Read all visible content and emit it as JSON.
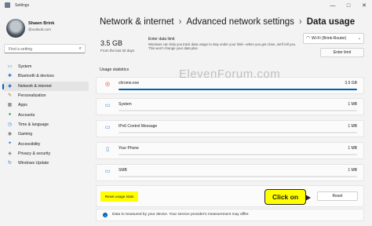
{
  "window": {
    "title": "Settings",
    "controls": [
      "—",
      "□",
      "✕"
    ]
  },
  "profile": {
    "name": "Shawn Brink",
    "email": "@outlook.com"
  },
  "search": {
    "placeholder": "Find a setting"
  },
  "nav": [
    {
      "label": "System",
      "icon": "monitor-icon",
      "glyph": "▭",
      "color": "#2b7bd6"
    },
    {
      "label": "Bluetooth & devices",
      "icon": "bluetooth-icon",
      "glyph": "✱",
      "color": "#2b7bd6"
    },
    {
      "label": "Network & internet",
      "icon": "network-icon",
      "glyph": "◆",
      "color": "#2b7bd6",
      "active": true
    },
    {
      "label": "Personalization",
      "icon": "brush-icon",
      "glyph": "✎",
      "color": "#c76a18"
    },
    {
      "label": "Apps",
      "icon": "apps-icon",
      "glyph": "▦",
      "color": "#6b6b6b"
    },
    {
      "label": "Accounts",
      "icon": "person-icon",
      "glyph": "●",
      "color": "#2b9b6b"
    },
    {
      "label": "Time & language",
      "icon": "clock-icon",
      "glyph": "◷",
      "color": "#2b7bd6"
    },
    {
      "label": "Gaming",
      "icon": "gamepad-icon",
      "glyph": "◉",
      "color": "#777"
    },
    {
      "label": "Accessibility",
      "icon": "accessibility-icon",
      "glyph": "✦",
      "color": "#2b7bd6"
    },
    {
      "label": "Privacy & security",
      "icon": "shield-icon",
      "glyph": "◈",
      "color": "#777"
    },
    {
      "label": "Windows Update",
      "icon": "update-icon",
      "glyph": "↻",
      "color": "#2b7bd6"
    }
  ],
  "breadcrumb": {
    "parts": [
      "Network & internet",
      "Advanced network settings"
    ],
    "current": "Data usage",
    "separator": "›"
  },
  "usage": {
    "amount": "3.5 GB",
    "period": "From the last 30 days"
  },
  "limit": {
    "title": "Enter data limit",
    "description": "Windows can help you track data usage to stay under your limit—when you get close, we'll tell you. This won't change your data plan",
    "button": "Enter limit"
  },
  "network_select": {
    "value": "Wi-Fi (Brink-Router)"
  },
  "stats": {
    "label": "Usage statistics",
    "apps": [
      {
        "name": "chrome.exe",
        "amount": "3.5 GB",
        "fraction": 1.0,
        "icon": "chrome-icon",
        "glyph": "◎"
      },
      {
        "name": "System",
        "amount": "1 MB",
        "fraction": 0.0,
        "icon": "system-icon",
        "glyph": "▭"
      },
      {
        "name": "IPv6 Control Message",
        "amount": "1 MB",
        "fraction": 0.0,
        "icon": "ipv6-icon",
        "glyph": "▭"
      },
      {
        "name": "Your Phone",
        "amount": "1 MB",
        "fraction": 0.0,
        "icon": "phone-icon",
        "glyph": "▯"
      },
      {
        "name": "SMB",
        "amount": "1 MB",
        "fraction": 0.0,
        "icon": "smb-icon",
        "glyph": "▭"
      }
    ]
  },
  "reset": {
    "label": "Reset usage stats",
    "button": "Reset",
    "callout": "Click on"
  },
  "info": {
    "text": "Data is measured by your device. Your service provider's measurement may differ."
  },
  "watermark": "ElevenForum.com",
  "colors": {
    "accent": "#005fb8",
    "highlight": "#ffff00"
  }
}
